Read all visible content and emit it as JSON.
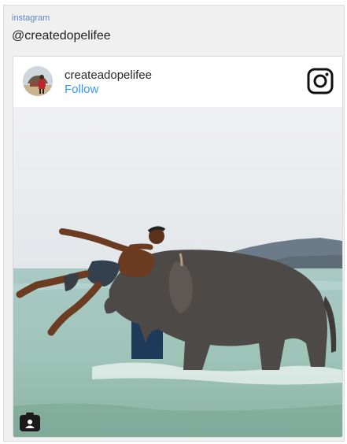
{
  "embed": {
    "source_label": "instagram",
    "handle": "@createdopelifee",
    "post": {
      "username": "createadopelifee",
      "follow_label": "Follow"
    }
  },
  "icons": {
    "header_logo": "instagram-glyph-icon",
    "corner_badge": "instagram-user-icon",
    "avatar": "profile-avatar"
  },
  "colors": {
    "follow": "#3897f0",
    "source_label": "#5b86c4",
    "username": "#262626",
    "sky": "#e8ebee",
    "sea": "#9cc4bb",
    "elephant": "#4b4744"
  }
}
